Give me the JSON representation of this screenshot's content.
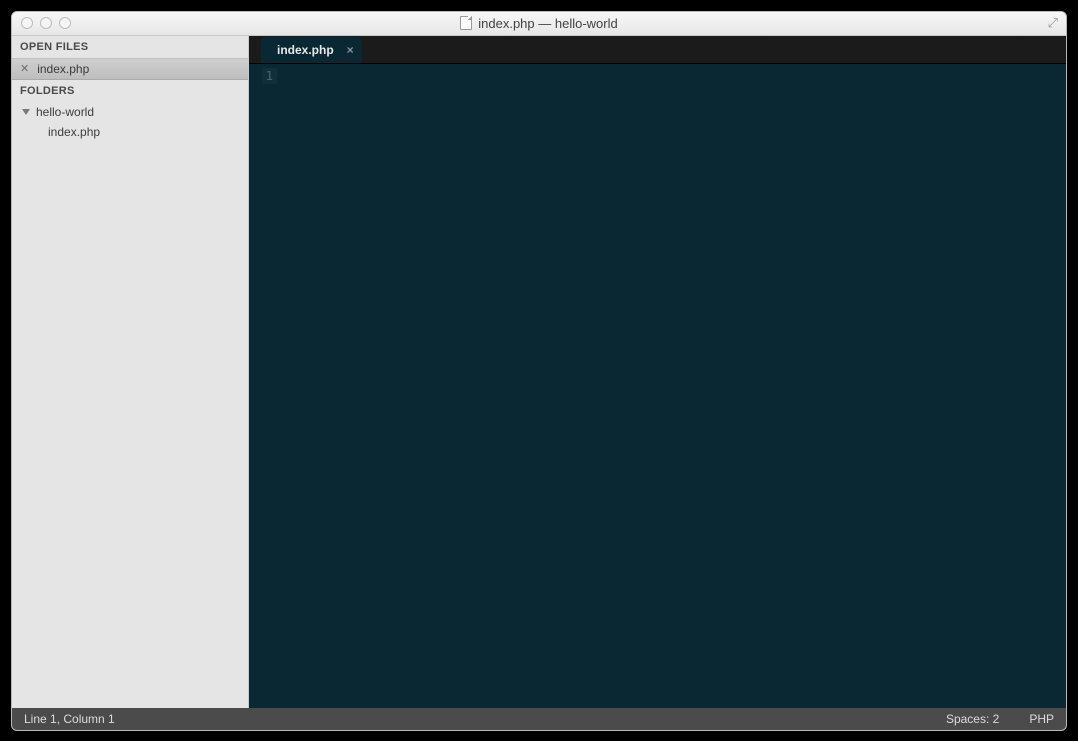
{
  "window": {
    "title": "index.php — hello-world"
  },
  "sidebar": {
    "openFilesHeader": "OPEN FILES",
    "foldersHeader": "FOLDERS",
    "openFiles": [
      {
        "name": "index.php"
      }
    ],
    "folders": [
      {
        "name": "hello-world",
        "files": [
          {
            "name": "index.php"
          }
        ]
      }
    ]
  },
  "tabs": [
    {
      "label": "index.php"
    }
  ],
  "editor": {
    "lineNumber": "1"
  },
  "status": {
    "cursor": "Line 1, Column 1",
    "spaces": "Spaces: 2",
    "syntax": "PHP"
  }
}
